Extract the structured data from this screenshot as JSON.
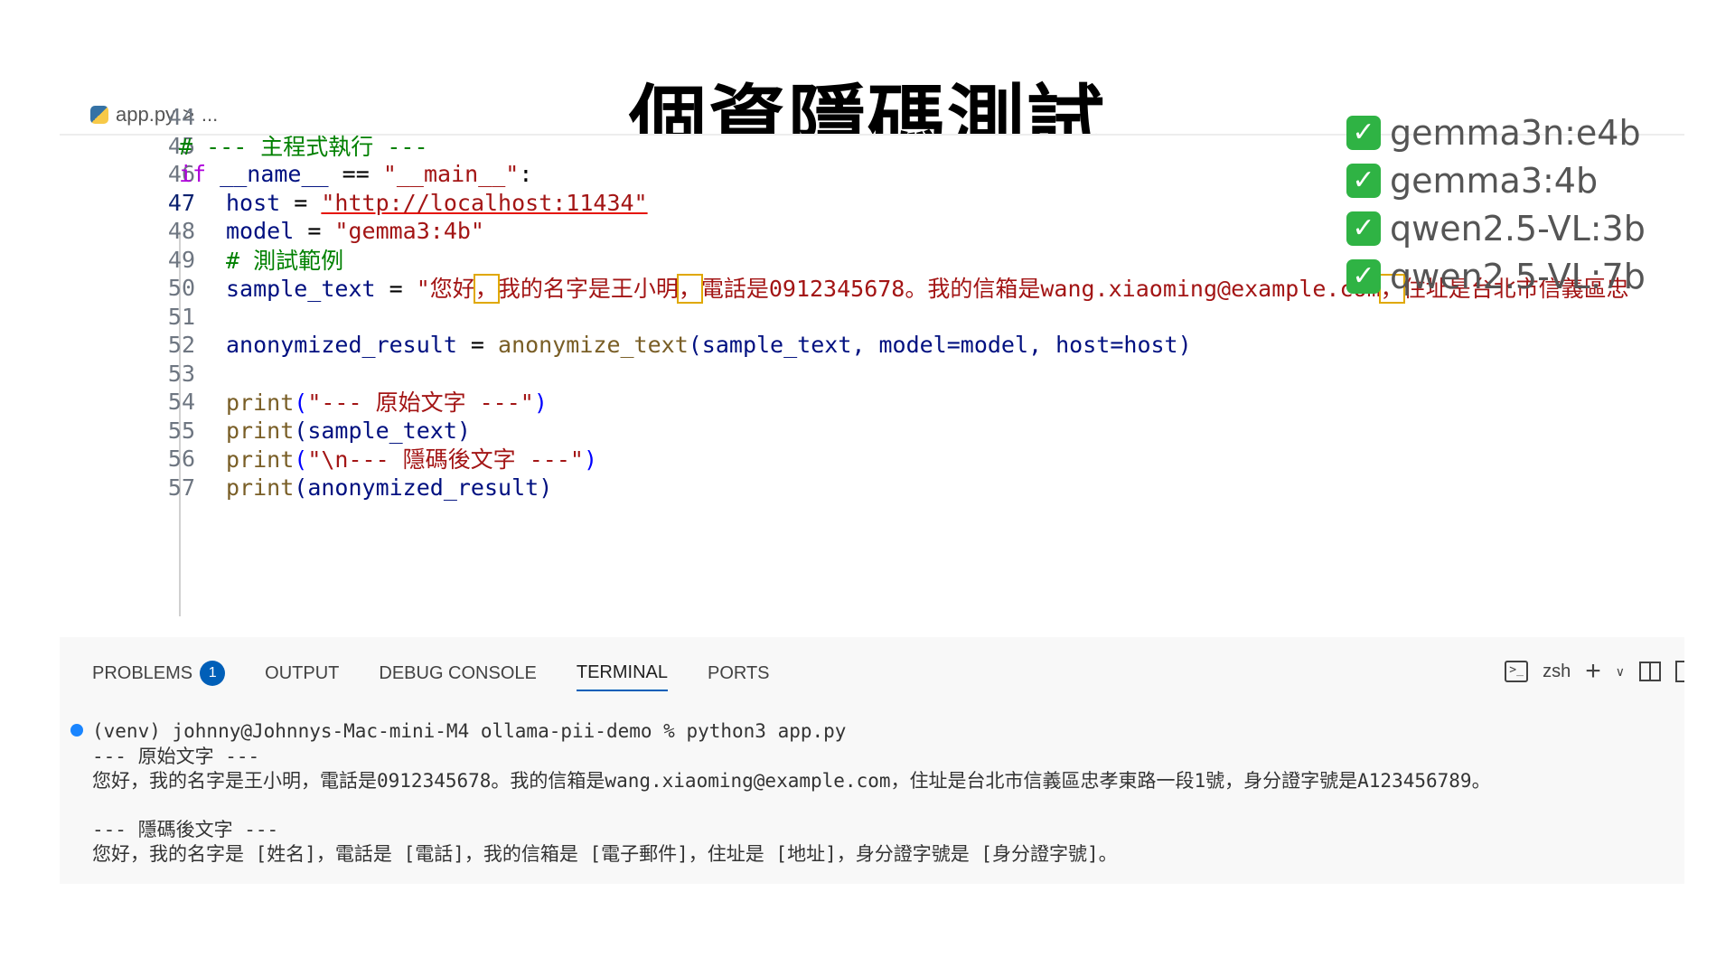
{
  "slide": {
    "title": "個資隱碼測試"
  },
  "editor": {
    "breadcrumb_file": "app.py",
    "breadcrumb_sep": ">",
    "breadcrumb_more": "...",
    "line_numbers": [
      "44",
      "45",
      "46",
      "47",
      "48",
      "49",
      "50",
      "51",
      "52",
      "53",
      "54",
      "55",
      "56",
      "57"
    ],
    "l45_comment": "# --- 主程式執行 ---",
    "l46_if": "if",
    "l46_name": "__name__",
    "l46_eq": " == ",
    "l46_main": "\"__main__\"",
    "l46_colon": ":",
    "l47_host": "host",
    "l47_eq": " = ",
    "l47_url": "\"http://localhost:11434\"",
    "l48_model": "model",
    "l48_eq": " = ",
    "l48_val": "\"gemma3:4b\"",
    "l49_comment": "# 測試範例",
    "l50_var": "sample_text",
    "l50_eq": " = ",
    "l50_s1": "\"您好",
    "l50_comma1": "，",
    "l50_s2": "我的名字是王小明",
    "l50_comma2": "，",
    "l50_s3": "電話是0912345678。我的信箱是wang.xiaoming@example.com",
    "l50_comma3": "，",
    "l50_s4": "住址是台北市信義區忠",
    "l52_var": "anonymized_result",
    "l52_eq": " = ",
    "l52_fn": "anonymize_text",
    "l52_args": "(sample_text, model=model, host=host)",
    "l54_fn": "print",
    "l54_open": "(",
    "l54_str": "\"--- 原始文字 ---\"",
    "l54_close": ")",
    "l55_fn": "print",
    "l55_args": "(sample_text)",
    "l56_fn": "print",
    "l56_open": "(",
    "l56_str": "\"\\n--- 隱碼後文字 ---\"",
    "l56_close": ")",
    "l57_fn": "print",
    "l57_args": "(anonymized_result)"
  },
  "models": {
    "check_glyph": "✓",
    "items": [
      "gemma3n:e4b",
      "gemma3:4b",
      "qwen2.5-VL:3b",
      "qwen2.5-VL:7b"
    ]
  },
  "panel": {
    "tabs": [
      "PROBLEMS",
      "OUTPUT",
      "DEBUG CONSOLE",
      "TERMINAL",
      "PORTS"
    ],
    "problems_count": "1",
    "shell_name": "zsh",
    "term_icon_glyph": ">_",
    "plus_glyph": "+",
    "chevron_glyph": "∨"
  },
  "terminal": {
    "lines": [
      "(venv) johnny@Johnnys-Mac-mini-M4 ollama-pii-demo % python3 app.py",
      "--- 原始文字 ---",
      "您好，我的名字是王小明，電話是0912345678。我的信箱是wang.xiaoming@example.com，住址是台北市信義區忠孝東路一段1號，身分證字號是A123456789。",
      "",
      "--- 隱碼後文字 ---",
      "您好，我的名字是 [姓名]，電話是 [電話]，我的信箱是 [電子郵件]，住址是 [地址]，身分證字號是 [身分證字號]。"
    ]
  },
  "colors": {
    "comment": "#008000",
    "keyword": "#af00db",
    "string": "#a31515",
    "variable": "#001080",
    "function": "#795e26",
    "accent": "#005fb8",
    "check": "#2fb344"
  }
}
